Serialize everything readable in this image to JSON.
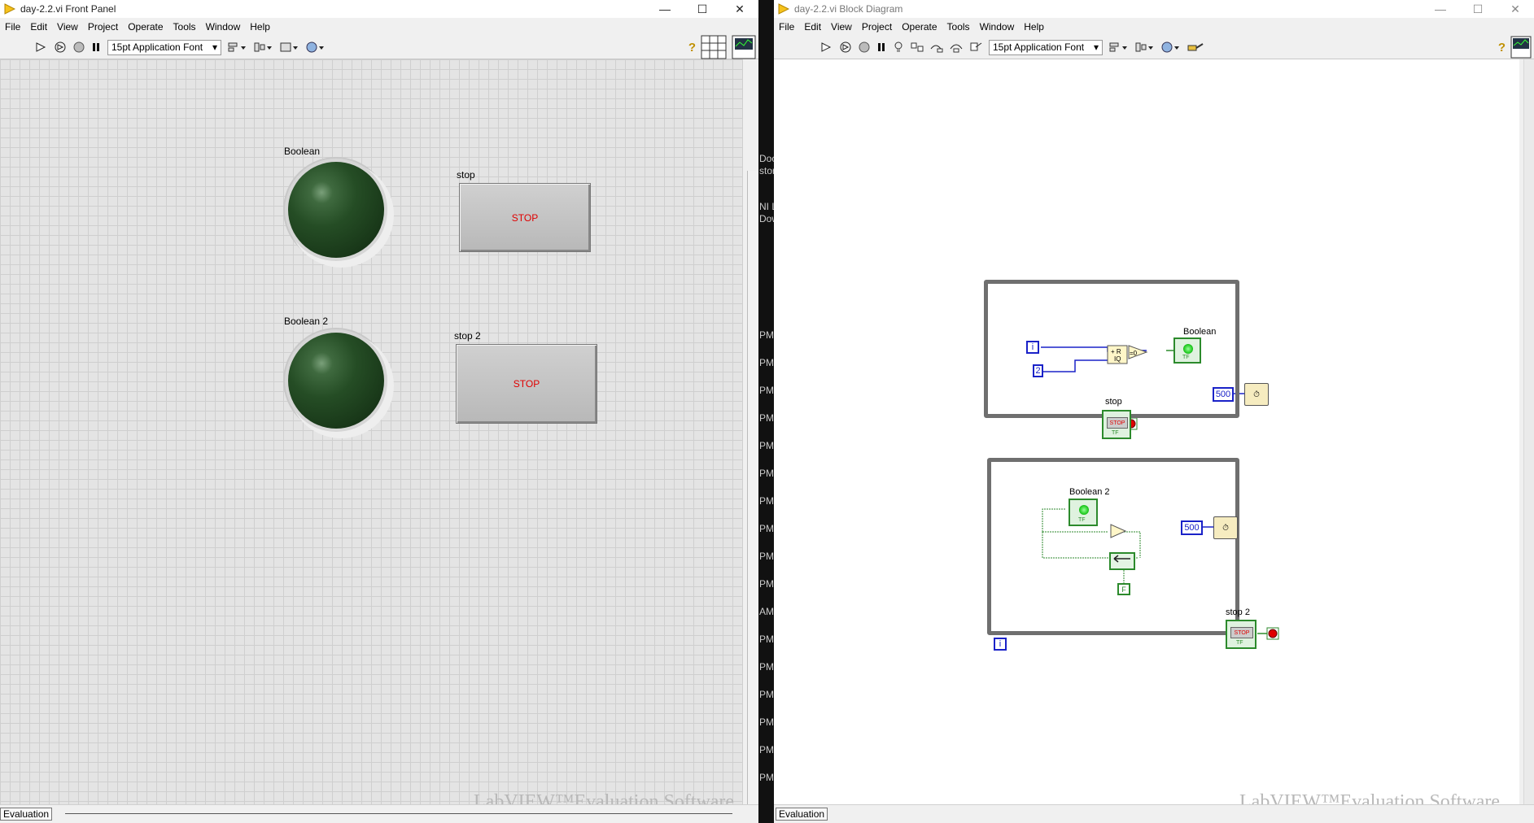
{
  "front_panel": {
    "title": "day-2.2.vi Front Panel",
    "menus": [
      "File",
      "Edit",
      "View",
      "Project",
      "Operate",
      "Tools",
      "Window",
      "Help"
    ],
    "font_selector": "15pt Application Font",
    "controls": {
      "boolean_label": "Boolean",
      "boolean2_label": "Boolean 2",
      "stop_label": "stop",
      "stop_text": "STOP",
      "stop2_label": "stop 2",
      "stop2_text": "STOP"
    },
    "watermark": "LabVIEW™Evaluation Software",
    "status": "Evaluation"
  },
  "block_diagram": {
    "title": "day-2.2.vi Block Diagram",
    "menus": [
      "File",
      "Edit",
      "View",
      "Project",
      "Operate",
      "Tools",
      "Window",
      "Help"
    ],
    "font_selector": "15pt Application Font",
    "nodes": {
      "iteration_terminal": "i",
      "const_two": "2",
      "boolean_label": "Boolean",
      "wait_const_1": "500",
      "stop_label": "stop",
      "boolean2_label": "Boolean 2",
      "wait_const_2": "500",
      "false_const": "F",
      "stop2_label": "stop 2",
      "iteration_terminal_2": "i",
      "quotient_text": "R\nIQ",
      "equal_zero_text": "=0",
      "stop_icon_text": "STOP"
    },
    "watermark": "LabVIEW™Evaluation Software",
    "status": "Evaluation"
  },
  "background_window_fragments": [
    "Docu",
    "store",
    "NI L",
    "Dow",
    "PM",
    "PM",
    "PM",
    "PM",
    "PM",
    "PM",
    "PM",
    "PM",
    "PM",
    "PM",
    "AM",
    "PM",
    "PM",
    "PM",
    "PM",
    "PM",
    "PM"
  ],
  "colors": {
    "led_off": "#1f4a1f",
    "stop_text": "#e00000",
    "numeric_wire": "#1a22c8",
    "boolean_wire": "#2c8a2c",
    "loop_border": "#6f6f6f"
  }
}
